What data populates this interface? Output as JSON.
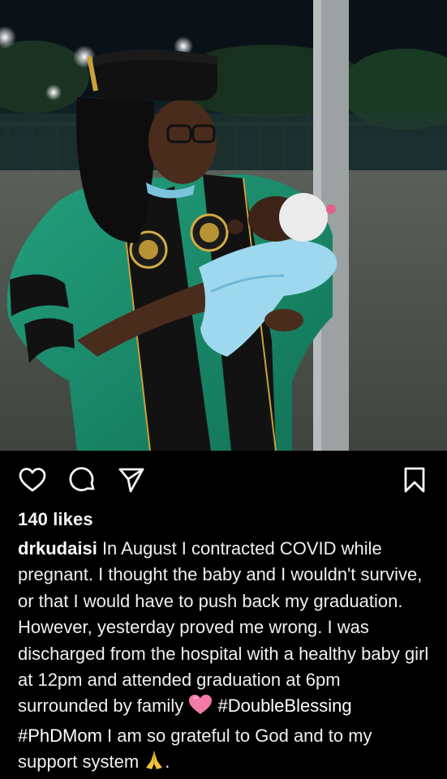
{
  "post": {
    "likes": "140 likes",
    "username": "drkudaisi",
    "caption_part1": "In August I contracted COVID while pregnant. I thought the baby and I wouldn't survive, or that I would have to push back my graduation. However, yesterday proved me wrong. I was discharged from the hospital with a healthy baby girl at 12pm and attended graduation at 6pm surrounded by family",
    "hashtag1": "#DoubleBlessing",
    "hashtag2": "#PhDMom",
    "caption_part2": "I am so grateful to God and to my support system",
    "caption_end": "."
  },
  "actions": {
    "like_icon": "heart-outline-icon",
    "comment_icon": "comment-bubble-icon",
    "share_icon": "paper-plane-icon",
    "save_icon": "bookmark-outline-icon"
  },
  "emojis": {
    "heart": "pink-heart-emoji",
    "pray": "folded-hands-emoji"
  },
  "colors": {
    "background": "#000000",
    "text": "#f5f5f5",
    "gown_green": "#1a8a6a",
    "velvet": "#141414"
  }
}
